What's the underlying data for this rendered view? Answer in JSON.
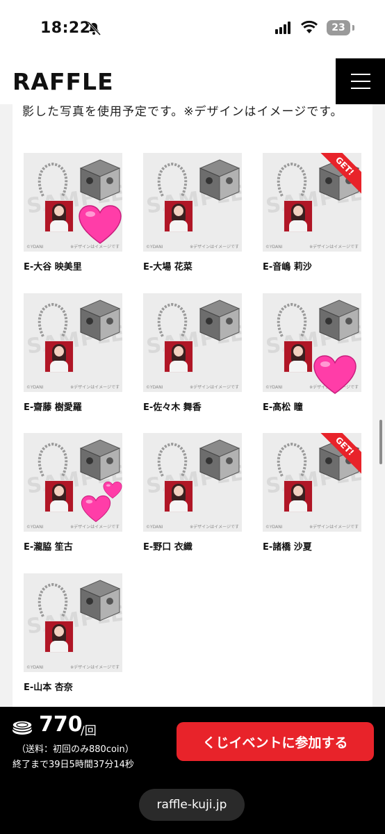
{
  "status_bar": {
    "time": "18:22",
    "battery": "23"
  },
  "header": {
    "logo": "RAFFLE"
  },
  "intro": {
    "cut_text": "影した写真を使用予定です。※デザインはイメージです。"
  },
  "thumbnail_text": {
    "watermark": "SAMPLE",
    "copyright": "©YDANI",
    "design_note": "※デザインはイメージです",
    "get_badge": "GET!"
  },
  "items": [
    {
      "label": "E-大谷 映美里",
      "get": false
    },
    {
      "label": "E-大場 花菜",
      "get": false
    },
    {
      "label": "E-音嶋 莉沙",
      "get": true
    },
    {
      "label": "E-齋藤 樹愛羅",
      "get": false
    },
    {
      "label": "E-佐々木 舞香",
      "get": false
    },
    {
      "label": "E-髙松 瞳",
      "get": false
    },
    {
      "label": "E-瀧脇 笙古",
      "get": false
    },
    {
      "label": "E-野口 衣織",
      "get": false
    },
    {
      "label": "E-諸橋 沙夏",
      "get": true
    },
    {
      "label": "E-山本 杏奈",
      "get": false
    }
  ],
  "purchase": {
    "price": "770",
    "per": "/回",
    "shipping": "（送料：初回のみ880coin）",
    "countdown": "終了まで39日5時間37分14秒",
    "button": "くじイベントに参加する"
  },
  "browser": {
    "url": "raffle-kuji.jp"
  },
  "colors": {
    "accent": "#e8232a",
    "heart": "#ff3da8",
    "bar": "#000000"
  }
}
